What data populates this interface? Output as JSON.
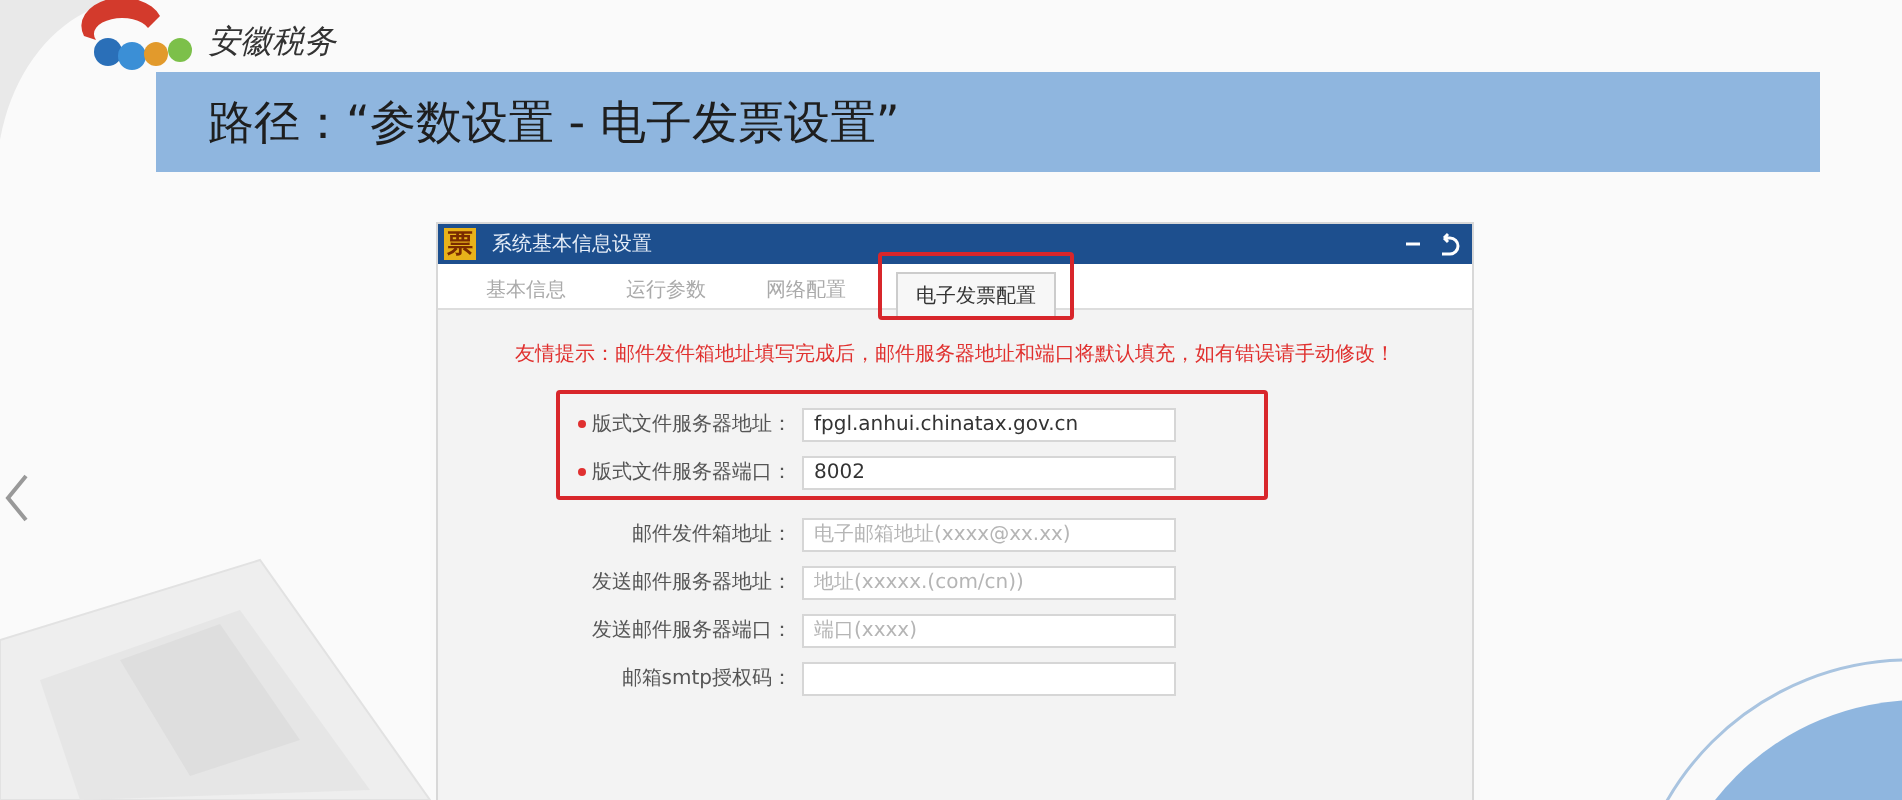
{
  "slide": {
    "brand": "安徽税务",
    "title": "路径：“参数设置 - 电子发票设置”"
  },
  "window": {
    "app_icon_text": "票",
    "title": "系统基本信息设置"
  },
  "tabs": [
    {
      "label": "基本信息",
      "selected": false,
      "highlighted": false
    },
    {
      "label": "运行参数",
      "selected": false,
      "highlighted": false
    },
    {
      "label": "网络配置",
      "selected": false,
      "highlighted": false
    },
    {
      "label": "电子发票配置",
      "selected": true,
      "highlighted": true
    }
  ],
  "notice": "友情提示：邮件发件箱地址填写完成后，邮件服务器地址和端口将默认填充，如有错误请手动修改！",
  "fields": [
    {
      "label": "版式文件服务器地址：",
      "required": true,
      "highlighted": true,
      "value": "fpgl.anhui.chinatax.gov.cn"
    },
    {
      "label": "版式文件服务器端口：",
      "required": true,
      "highlighted": true,
      "value": "8002"
    },
    {
      "label": "邮件发件箱地址：",
      "required": false,
      "highlighted": false,
      "placeholder": "电子邮箱地址(xxxx@xx.xx)"
    },
    {
      "label": "发送邮件服务器地址：",
      "required": false,
      "highlighted": false,
      "placeholder": "地址(xxxxx.(com/cn))"
    },
    {
      "label": "发送邮件服务器端口：",
      "required": false,
      "highlighted": false,
      "placeholder": "端口(xxxx)"
    },
    {
      "label": "邮箱smtp授权码：",
      "required": false,
      "highlighted": false
    }
  ]
}
